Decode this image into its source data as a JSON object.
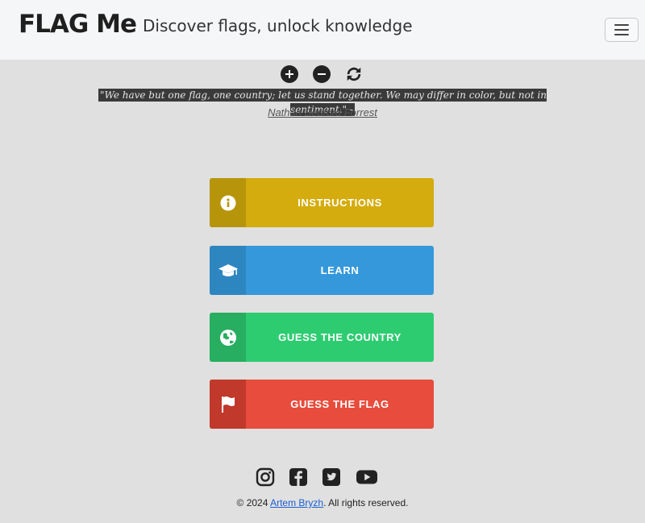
{
  "header": {
    "brand": "FLAG Me",
    "tagline": "Discover flags, unlock knowledge",
    "menu_icon": "hamburger-icon"
  },
  "controls": {
    "zoom_in_icon": "plus-circle-icon",
    "zoom_out_icon": "minus-circle-icon",
    "refresh_icon": "refresh-icon"
  },
  "quote": {
    "text": "\"We have but one flag, one country; let us stand together. We may differ in color, but not in sentiment.\" -",
    "author": "Nathan Bedford Forrest"
  },
  "menu": [
    {
      "label": "INSTRUCTIONS",
      "icon": "info-icon",
      "color": "#d4ac0d"
    },
    {
      "label": "LEARN",
      "icon": "graduation-cap-icon",
      "color": "#3498db"
    },
    {
      "label": "GUESS THE COUNTRY",
      "icon": "globe-icon",
      "color": "#2ecc71"
    },
    {
      "label": "GUESS THE FLAG",
      "icon": "flag-icon",
      "color": "#e74c3c"
    }
  ],
  "social": [
    "instagram-icon",
    "facebook-icon",
    "twitter-icon",
    "youtube-icon"
  ],
  "footer": {
    "prefix": "© 2024 ",
    "author_link": "Artem Bryzh",
    "suffix": ". All rights reserved."
  }
}
